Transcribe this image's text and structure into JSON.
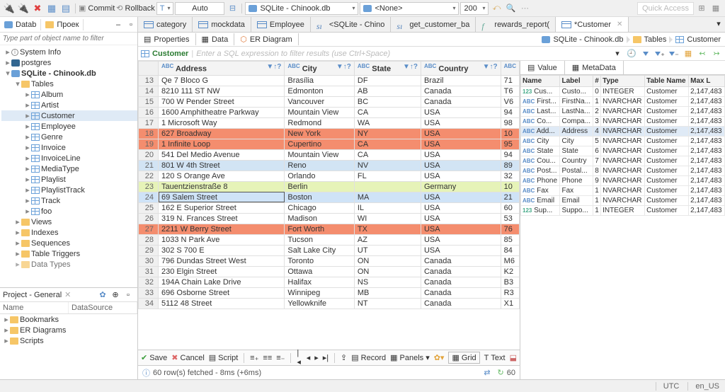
{
  "toolbar": {
    "commitLabel": "Commit",
    "rollbackLabel": "Rollback",
    "txMode": "Auto",
    "dbDropdown": "SQLite - Chinook.db",
    "schemaDropdown": "<None>",
    "rowLimit": "200",
    "quickAccess": "Quick Access"
  },
  "sidebar": {
    "tab1": "Datab",
    "tab2": "Проек",
    "searchPlaceholder": "Type part of object name to filter",
    "tree": {
      "systemInfo": "System Info",
      "postgres": "postgres",
      "chinook": "SQLite - Chinook.db",
      "tables": "Tables",
      "items": [
        "Album",
        "Artist",
        "Customer",
        "Employee",
        "Genre",
        "Invoice",
        "InvoiceLine",
        "MediaType",
        "Playlist",
        "PlaylistTrack",
        "Track",
        "foo"
      ],
      "views": "Views",
      "indexes": "Indexes",
      "sequences": "Sequences",
      "tableTriggers": "Table Triggers",
      "dataTypes": "Data Types"
    },
    "bottom": {
      "title": "Project - General",
      "col1": "Name",
      "col2": "DataSource",
      "items": [
        "Bookmarks",
        "ER Diagrams",
        "Scripts"
      ]
    }
  },
  "editorTabs": {
    "t1": "category",
    "t2": "mockdata",
    "t3": "Employee",
    "t4": "<SQLite - Chino",
    "t5": "get_customer_ba",
    "t6": "rewards_report(",
    "t7": "*Customer"
  },
  "subTabs": {
    "props": "Properties",
    "data": "Data",
    "er": "ER Diagram"
  },
  "crumb": {
    "db": "SQLite - Chinook.db",
    "tables": "Tables",
    "tbl": "Customer"
  },
  "filter": {
    "label": "Customer",
    "placeholder": "Enter a SQL expression to filter results (use Ctrl+Space)"
  },
  "columns": {
    "address": "Address",
    "city": "City",
    "state": "State",
    "country": "Country"
  },
  "rows": [
    {
      "n": 13,
      "cls": "",
      "addr": "Qe 7 Bloco G",
      "city": "Brasília",
      "state": "DF",
      "country": "Brazil",
      "x": "71"
    },
    {
      "n": 14,
      "cls": "",
      "addr": "8210 111 ST NW",
      "city": "Edmonton",
      "state": "AB",
      "country": "Canada",
      "x": "T6"
    },
    {
      "n": 15,
      "cls": "",
      "addr": "700 W Pender Street",
      "city": "Vancouver",
      "state": "BC",
      "country": "Canada",
      "x": "V6"
    },
    {
      "n": 16,
      "cls": "",
      "addr": "1600 Amphitheatre Parkway",
      "city": "Mountain View",
      "state": "CA",
      "country": "USA",
      "x": "94"
    },
    {
      "n": 17,
      "cls": "",
      "addr": "1 Microsoft Way",
      "city": "Redmond",
      "state": "WA",
      "country": "USA",
      "x": "98"
    },
    {
      "n": 18,
      "cls": "rowred",
      "addr": "627 Broadway",
      "city": "New York",
      "state": "NY",
      "country": "USA",
      "x": "10"
    },
    {
      "n": 19,
      "cls": "rowred",
      "addr": "1 Infinite Loop",
      "city": "Cupertino",
      "state": "CA",
      "country": "USA",
      "x": "95"
    },
    {
      "n": 20,
      "cls": "",
      "addr": "541 Del Medio Avenue",
      "city": "Mountain View",
      "state": "CA",
      "country": "USA",
      "x": "94"
    },
    {
      "n": 21,
      "cls": "rowblue",
      "addr": "801 W 4th Street",
      "city": "Reno",
      "state": "NV",
      "country": "USA",
      "x": "89"
    },
    {
      "n": 22,
      "cls": "",
      "addr": "120 S Orange Ave",
      "city": "Orlando",
      "state": "FL",
      "country": "USA",
      "x": "32"
    },
    {
      "n": 23,
      "cls": "rowgreen",
      "addr": "Tauentzienstraße 8",
      "city": "Berlin",
      "state": "",
      "country": "Germany",
      "x": "10"
    },
    {
      "n": 24,
      "cls": "rowsel",
      "addr": "69 Salem Street",
      "city": "Boston",
      "state": "MA",
      "country": "USA",
      "x": "21",
      "sel": true
    },
    {
      "n": 25,
      "cls": "",
      "addr": "162 E Superior Street",
      "city": "Chicago",
      "state": "IL",
      "country": "USA",
      "x": "60"
    },
    {
      "n": 26,
      "cls": "",
      "addr": "319 N. Frances Street",
      "city": "Madison",
      "state": "WI",
      "country": "USA",
      "x": "53"
    },
    {
      "n": 27,
      "cls": "rowred",
      "addr": "2211 W Berry Street",
      "city": "Fort Worth",
      "state": "TX",
      "country": "USA",
      "x": "76"
    },
    {
      "n": 28,
      "cls": "",
      "addr": "1033 N Park Ave",
      "city": "Tucson",
      "state": "AZ",
      "country": "USA",
      "x": "85"
    },
    {
      "n": 29,
      "cls": "",
      "addr": "302 S 700 E",
      "city": "Salt Lake City",
      "state": "UT",
      "country": "USA",
      "x": "84"
    },
    {
      "n": 30,
      "cls": "",
      "addr": "796 Dundas Street West",
      "city": "Toronto",
      "state": "ON",
      "country": "Canada",
      "x": "M6"
    },
    {
      "n": 31,
      "cls": "",
      "addr": "230 Elgin Street",
      "city": "Ottawa",
      "state": "ON",
      "country": "Canada",
      "x": "K2"
    },
    {
      "n": 32,
      "cls": "",
      "addr": "194A Chain Lake Drive",
      "city": "Halifax",
      "state": "NS",
      "country": "Canada",
      "x": "B3"
    },
    {
      "n": 33,
      "cls": "",
      "addr": "696 Osborne Street",
      "city": "Winnipeg",
      "state": "MB",
      "country": "Canada",
      "x": "R3"
    },
    {
      "n": 34,
      "cls": "",
      "addr": "5112 48 Street",
      "city": "Yellowknife",
      "state": "NT",
      "country": "Canada",
      "x": "X1"
    }
  ],
  "meta": {
    "tabValue": "Value",
    "tabMeta": "MetaData",
    "cols": {
      "name": "Name",
      "label": "Label",
      "num": "#",
      "type": "Type",
      "tbl": "Table Name",
      "max": "Max L"
    },
    "rows": [
      {
        "ico": "123",
        "name": "Cus...",
        "label": "Custo...",
        "n": "0",
        "type": "INTEGER",
        "tbl": "Customer",
        "max": "2,147,483"
      },
      {
        "ico": "abc",
        "name": "First...",
        "label": "FirstNa...",
        "n": "1",
        "type": "NVARCHAR",
        "tbl": "Customer",
        "max": "2,147,483"
      },
      {
        "ico": "abc",
        "name": "Last...",
        "label": "LastNa...",
        "n": "2",
        "type": "NVARCHAR",
        "tbl": "Customer",
        "max": "2,147,483"
      },
      {
        "ico": "abc",
        "name": "Co...",
        "label": "Compa...",
        "n": "3",
        "type": "NVARCHAR",
        "tbl": "Customer",
        "max": "2,147,483"
      },
      {
        "ico": "abc",
        "name": "Add...",
        "label": "Address",
        "n": "4",
        "type": "NVARCHAR",
        "tbl": "Customer",
        "max": "2,147,483",
        "sel": true
      },
      {
        "ico": "abc",
        "name": "City",
        "label": "City",
        "n": "5",
        "type": "NVARCHAR",
        "tbl": "Customer",
        "max": "2,147,483"
      },
      {
        "ico": "abc",
        "name": "State",
        "label": "State",
        "n": "6",
        "type": "NVARCHAR",
        "tbl": "Customer",
        "max": "2,147,483"
      },
      {
        "ico": "abc",
        "name": "Cou...",
        "label": "Country",
        "n": "7",
        "type": "NVARCHAR",
        "tbl": "Customer",
        "max": "2,147,483"
      },
      {
        "ico": "abc",
        "name": "Post...",
        "label": "Postal...",
        "n": "8",
        "type": "NVARCHAR",
        "tbl": "Customer",
        "max": "2,147,483"
      },
      {
        "ico": "abc",
        "name": "Phone",
        "label": "Phone",
        "n": "9",
        "type": "NVARCHAR",
        "tbl": "Customer",
        "max": "2,147,483"
      },
      {
        "ico": "abc",
        "name": "Fax",
        "label": "Fax",
        "n": "1",
        "type": "NVARCHAR",
        "tbl": "Customer",
        "max": "2,147,483"
      },
      {
        "ico": "abc",
        "name": "Email",
        "label": "Email",
        "n": "1",
        "type": "NVARCHAR",
        "tbl": "Customer",
        "max": "2,147,483"
      },
      {
        "ico": "123",
        "name": "Sup...",
        "label": "Suppo...",
        "n": "1",
        "type": "INTEGER",
        "tbl": "Customer",
        "max": "2,147,483"
      }
    ]
  },
  "gridBottom": {
    "save": "Save",
    "cancel": "Cancel",
    "script": "Script",
    "record": "Record",
    "panels": "Panels",
    "grid": "Grid",
    "text": "Text"
  },
  "status": {
    "fetched": "60 row(s) fetched - 8ms (+6ms)",
    "rowcount": "60"
  },
  "appStatus": {
    "tz": "UTC",
    "locale": "en_US"
  }
}
